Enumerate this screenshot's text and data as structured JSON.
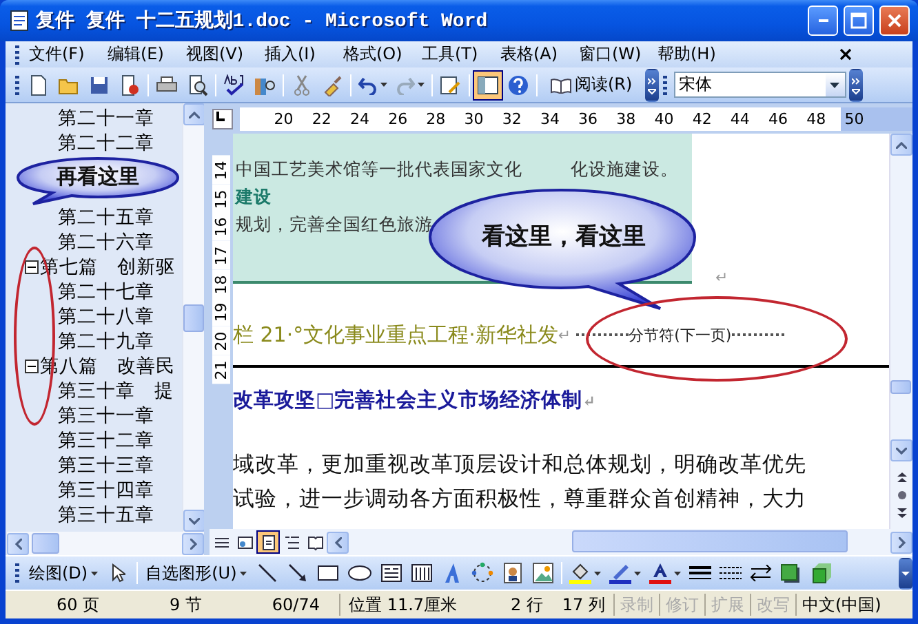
{
  "window": {
    "title": "复件 复件 十二五规划1.doc - Microsoft Word"
  },
  "menu_bar": {
    "items": [
      "文件(F)",
      "编辑(E)",
      "视图(V)",
      "插入(I)",
      "格式(O)",
      "工具(T)",
      "表格(A)",
      "窗口(W)",
      "帮助(H)"
    ]
  },
  "toolbar": {
    "document_map_button": {
      "on": true
    },
    "read_button": "阅读(R)",
    "font_field": {
      "value": "宋体"
    }
  },
  "ruler": {
    "marks": [
      "20",
      "22",
      "24",
      "26",
      "28",
      "30",
      "32",
      "34",
      "36",
      "38",
      "40",
      "42",
      "44",
      "46",
      "48",
      "50"
    ]
  },
  "vertical_ruler": {
    "marks": [
      "14",
      "15",
      "16",
      "17",
      "18",
      "19",
      "20",
      "21"
    ]
  },
  "doc_map": {
    "items_before_callout": [
      "第二十一章",
      "第二十二章"
    ],
    "items_after_callout": [
      "第二十五章",
      "第二十六章"
    ],
    "parts": [
      {
        "label": "第七篇　创新驱",
        "expanded": true,
        "children": [
          "第二十七章",
          "第二十八章",
          "第二十九章"
        ]
      },
      {
        "label": "第八篇　改善民",
        "expanded": true,
        "children": [
          "第三十章　提",
          "第三十一章",
          "第三十二章",
          "第三十三章",
          "第三十四章",
          "第三十五章"
        ]
      }
    ]
  },
  "callouts": [
    {
      "text": "再看这里"
    },
    {
      "text": "看这里，看这里"
    }
  ],
  "document": {
    "shaded_box": {
      "line_1_left": "中国工艺美术馆等一批代表国家文化",
      "line_1_right": "化设施建设。",
      "subheading": "建设",
      "line_3": "规划，完善全国红色旅游"
    },
    "caption": "栏 21·°文化事业重点工程·新华社发",
    "section_break": "分节符(下一页)",
    "paragraph_mark": "↵",
    "heading": "改革攻坚□完善社会主义市场经济体制",
    "paragraph_lines": [
      "域改革，更加重视改革顶层设计和总体规划，明确改革优先",
      "试验，进一步调动各方面积极性，尊重群众首创精神，大力"
    ]
  },
  "view_buttons": [
    {
      "kind": "normal",
      "selected": false
    },
    {
      "kind": "web",
      "selected": false
    },
    {
      "kind": "print",
      "selected": true
    },
    {
      "kind": "outline",
      "selected": false
    },
    {
      "kind": "reading",
      "selected": false
    }
  ],
  "drawing_toolbar": {
    "draw_menu": "绘图(D)",
    "autoshapes_menu": "自选图形(U)"
  },
  "status_bar": {
    "page": "60 页",
    "section": "9 节",
    "page_count": "60/74",
    "position": "位置 11.7厘米",
    "line": "2 行",
    "column": "17 列",
    "modes": [
      {
        "label": "录制",
        "on": false
      },
      {
        "label": "修订",
        "on": false
      },
      {
        "label": "扩展",
        "on": false
      },
      {
        "label": "改写",
        "on": false
      }
    ],
    "language": "中文(中国)"
  }
}
